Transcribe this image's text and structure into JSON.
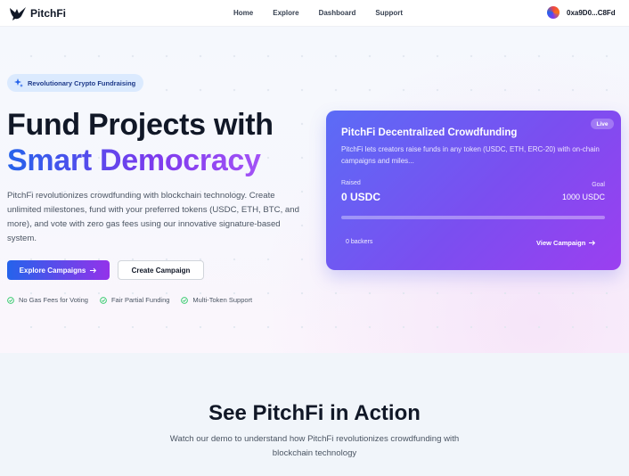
{
  "nav": {
    "brand": "PitchFi",
    "links": [
      "Home",
      "Explore",
      "Dashboard",
      "Support"
    ],
    "wallet_address": "0xa9D0...C8Fd"
  },
  "hero": {
    "badge": "Revolutionary Crypto Fundraising",
    "title_line1": "Fund Projects with",
    "title_line2": "Smart Democracy",
    "description": "PitchFi revolutionizes crowdfunding with blockchain technology. Create unlimited milestones, fund with your preferred tokens (USDC, ETH, BTC, and more), and vote with zero gas fees using our innovative signature-based system.",
    "primary_cta": "Explore Campaigns",
    "secondary_cta": "Create Campaign",
    "features": [
      "No Gas Fees for Voting",
      "Fair Partial Funding",
      "Multi-Token Support"
    ]
  },
  "campaign_card": {
    "status": "Live",
    "title": "PitchFi Decentralized Crowdfunding",
    "description": "PitchFi lets creators raise funds in any token (USDC, ETH, ERC-20) with on-chain campaigns and miles...",
    "raised_label": "Raised",
    "raised_value": "0 USDC",
    "goal_label": "Goal",
    "goal_value": "1000 USDC",
    "progress_fraction": 0,
    "backers": "0 backers",
    "view_link": "View Campaign"
  },
  "demo_section": {
    "title": "See PitchFi in Action",
    "subtitle": "Watch our demo to understand how PitchFi revolutionizes crowdfunding with blockchain technology"
  },
  "colors": {
    "accent_blue": "#2563eb",
    "accent_purple": "#9333ea",
    "check_green": "#22c55e"
  }
}
